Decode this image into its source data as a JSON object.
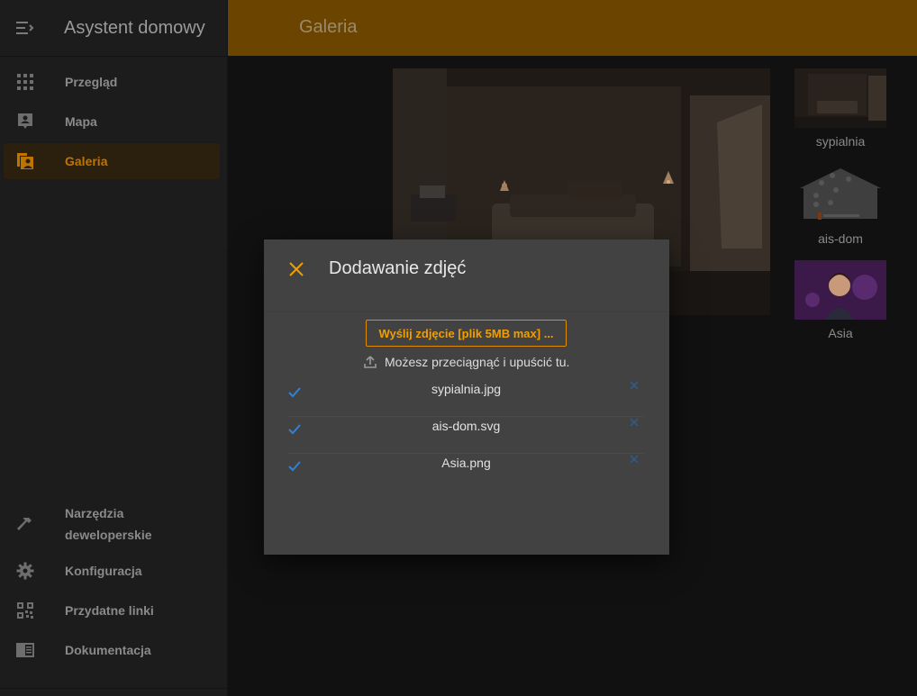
{
  "app": {
    "title": "Asystent domowy"
  },
  "nav": {
    "top": [
      {
        "label": "Przegląd",
        "icon": "grid-icon"
      },
      {
        "label": "Mapa",
        "icon": "map-account-icon"
      },
      {
        "label": "Galeria",
        "icon": "gallery-icon",
        "active": true
      }
    ],
    "bottom": [
      {
        "label": "Narzędzia deweloperskie",
        "icon": "hammer-icon"
      },
      {
        "label": "Konfiguracja",
        "icon": "gear-icon"
      },
      {
        "label": "Przydatne linki",
        "icon": "qrcode-icon"
      },
      {
        "label": "Dokumentacja",
        "icon": "book-icon"
      }
    ]
  },
  "topbar": {
    "title": "Galeria"
  },
  "gallery": {
    "thumbs": [
      {
        "label": "sypialnia"
      },
      {
        "label": "ais-dom"
      },
      {
        "label": "Asia"
      }
    ]
  },
  "dialog": {
    "title": "Dodawanie zdjęć",
    "upload_label": "Wyślij zdjęcie [plik 5MB max] ...",
    "drop_hint": "Możesz przeciągnąć i upuścić tu.",
    "files": [
      {
        "name": "sypialnia.jpg"
      },
      {
        "name": "ais-dom.svg"
      },
      {
        "name": "Asia.png"
      }
    ]
  },
  "colors": {
    "accent": "#f19f00",
    "check": "#2f82d6",
    "topbar": "#6b4500"
  }
}
